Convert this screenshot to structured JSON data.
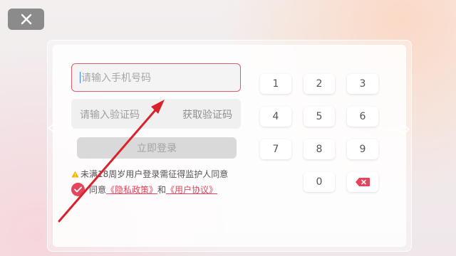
{
  "close_button": {
    "icon": "close-icon"
  },
  "login": {
    "phone_placeholder": "请输入手机号码",
    "code_placeholder": "请输入验证码",
    "get_code_label": "获取验证码",
    "login_button_label": "立即登录",
    "age_warning": "未满18周岁用户登录需征得监护人同意",
    "agree_prefix": "同意",
    "privacy_link": "《隐私政策》",
    "agree_and": "和",
    "user_agreement_link": "《用户协议》"
  },
  "keypad": {
    "keys": [
      "1",
      "2",
      "3",
      "4",
      "5",
      "6",
      "7",
      "8",
      "9",
      "0"
    ],
    "delete_icon": "backspace-icon"
  },
  "colors": {
    "accent": "#e2455c",
    "close_bg": "#8b8b8b",
    "warning": "#f0b400"
  }
}
